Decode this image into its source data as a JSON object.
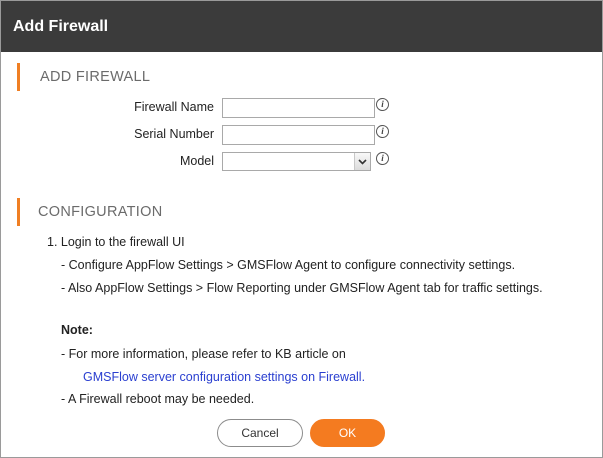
{
  "dialog": {
    "title": "Add Firewall"
  },
  "add_firewall": {
    "heading": "ADD FIREWALL",
    "fields": {
      "firewall_name": {
        "label": "Firewall Name",
        "value": ""
      },
      "serial_number": {
        "label": "Serial Number",
        "value": ""
      },
      "model": {
        "label": "Model",
        "value": ""
      }
    },
    "info_glyph": "i"
  },
  "configuration": {
    "heading": "CONFIGURATION",
    "step1": "1. Login to the firewall UI",
    "step1_a": "- Configure AppFlow Settings > GMSFlow Agent to configure connectivity settings.",
    "step1_b": "- Also AppFlow Settings > Flow Reporting under GMSFlow Agent tab for traffic settings.",
    "note_label": "Note:",
    "note_1": "- For more information, please refer to KB article on",
    "note_link": "GMSFlow server configuration settings on Firewall.",
    "note_2": "- A Firewall reboot may be needed."
  },
  "buttons": {
    "cancel": "Cancel",
    "ok": "OK"
  },
  "colors": {
    "titlebar": "#3b3b3b",
    "accent": "#f47b20",
    "link": "#2a3fd0"
  },
  "icons": {
    "info": "info-icon",
    "dropdown": "chevron-down-icon"
  }
}
